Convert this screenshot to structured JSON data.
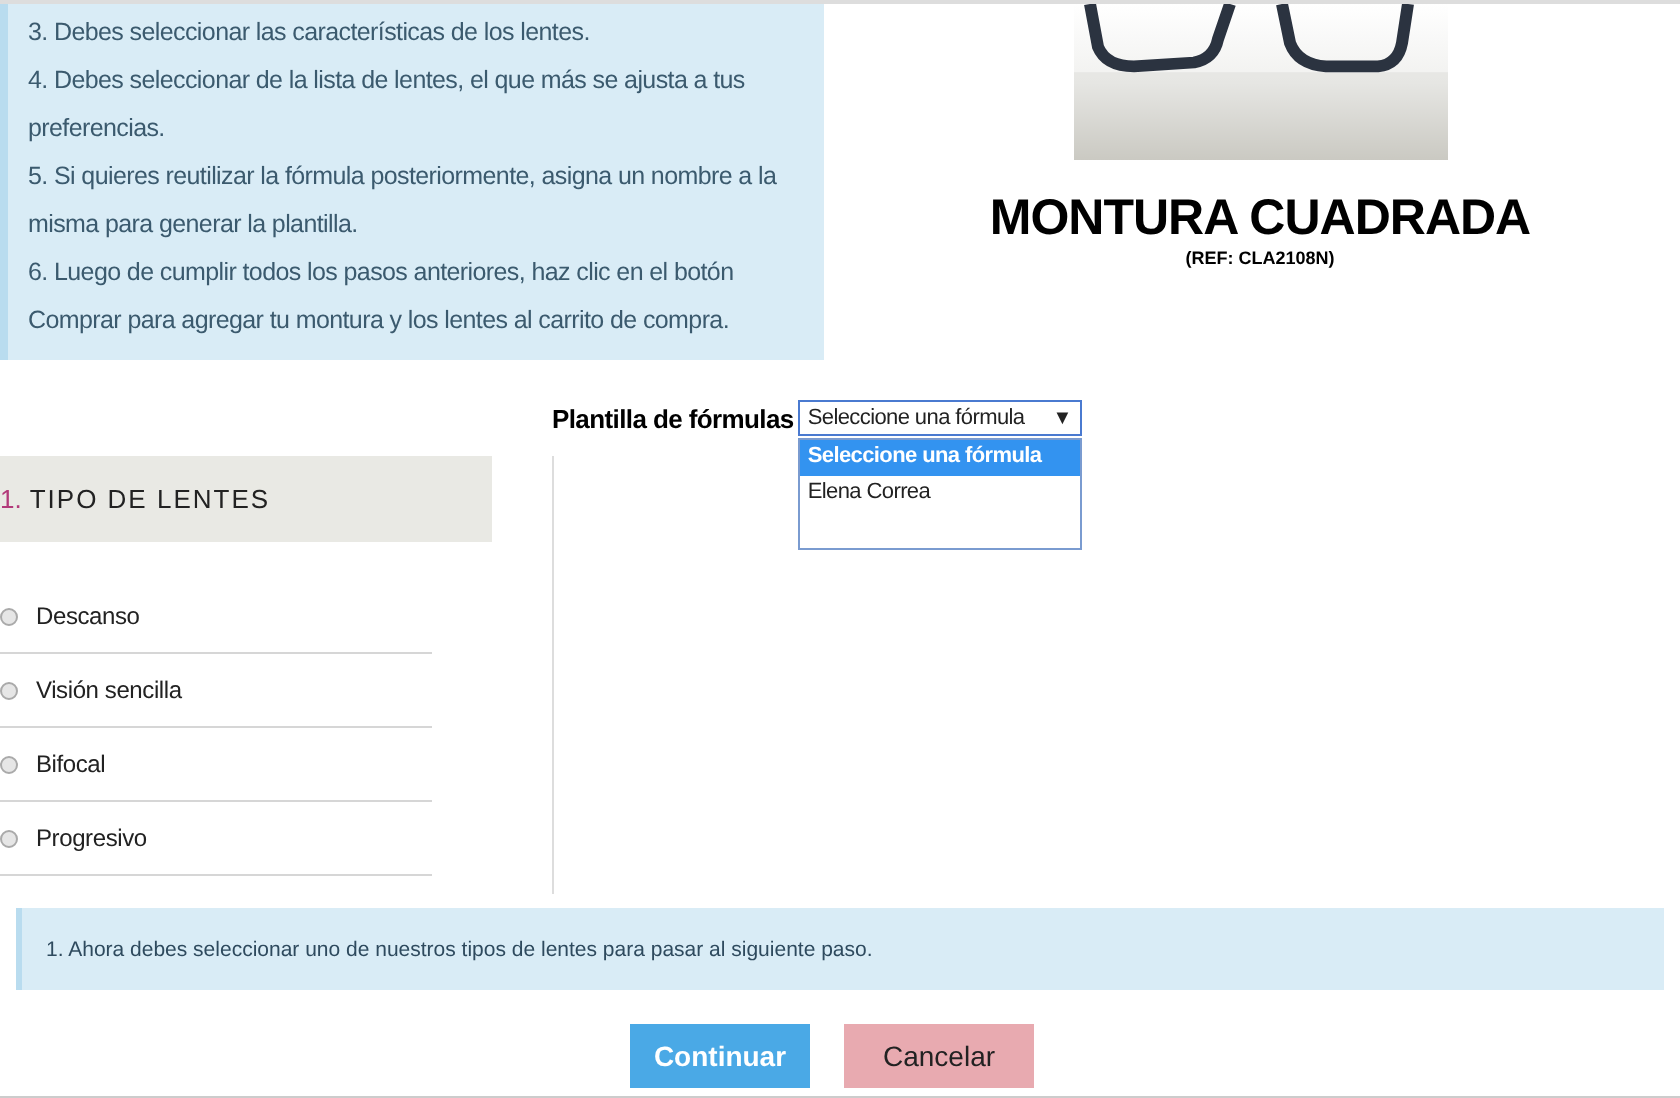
{
  "instructions": [
    "3. Debes seleccionar las características de los lentes.",
    "4. Debes seleccionar de la lista de lentes, el que más se ajusta a tus preferencias.",
    "5. Si quieres reutilizar la fórmula posteriormente, asigna un nombre a la misma para generar la plantilla.",
    "6. Luego de cumplir todos los pasos anteriores, haz clic en el botón Comprar para agregar tu montura y los lentes al carrito de compra."
  ],
  "product": {
    "title": "MONTURA CUADRADA",
    "ref": "(REF: CLA2108N)"
  },
  "template": {
    "label": "Plantilla de fórmulas",
    "value": "Seleccione una fórmula",
    "arrow": "▼",
    "expanded": true,
    "options": [
      {
        "label": "Seleccione una fórmula",
        "selected": true
      },
      {
        "label": "Elena Correa",
        "selected": false
      }
    ]
  },
  "section": {
    "number": "1.",
    "title": "TIPO DE LENTES"
  },
  "lens_types": [
    {
      "label": "Descanso",
      "checked": false
    },
    {
      "label": "Visión sencilla",
      "checked": false
    },
    {
      "label": "Bifocal",
      "checked": false
    },
    {
      "label": "Progresivo",
      "checked": false
    }
  ],
  "notice": "1. Ahora debes seleccionar uno de nuestros tipos de lentes para pasar al siguiente paso.",
  "buttons": [
    {
      "label": "Continuar",
      "kind": "primary"
    },
    {
      "label": "Cancelar",
      "kind": "secondary"
    }
  ]
}
